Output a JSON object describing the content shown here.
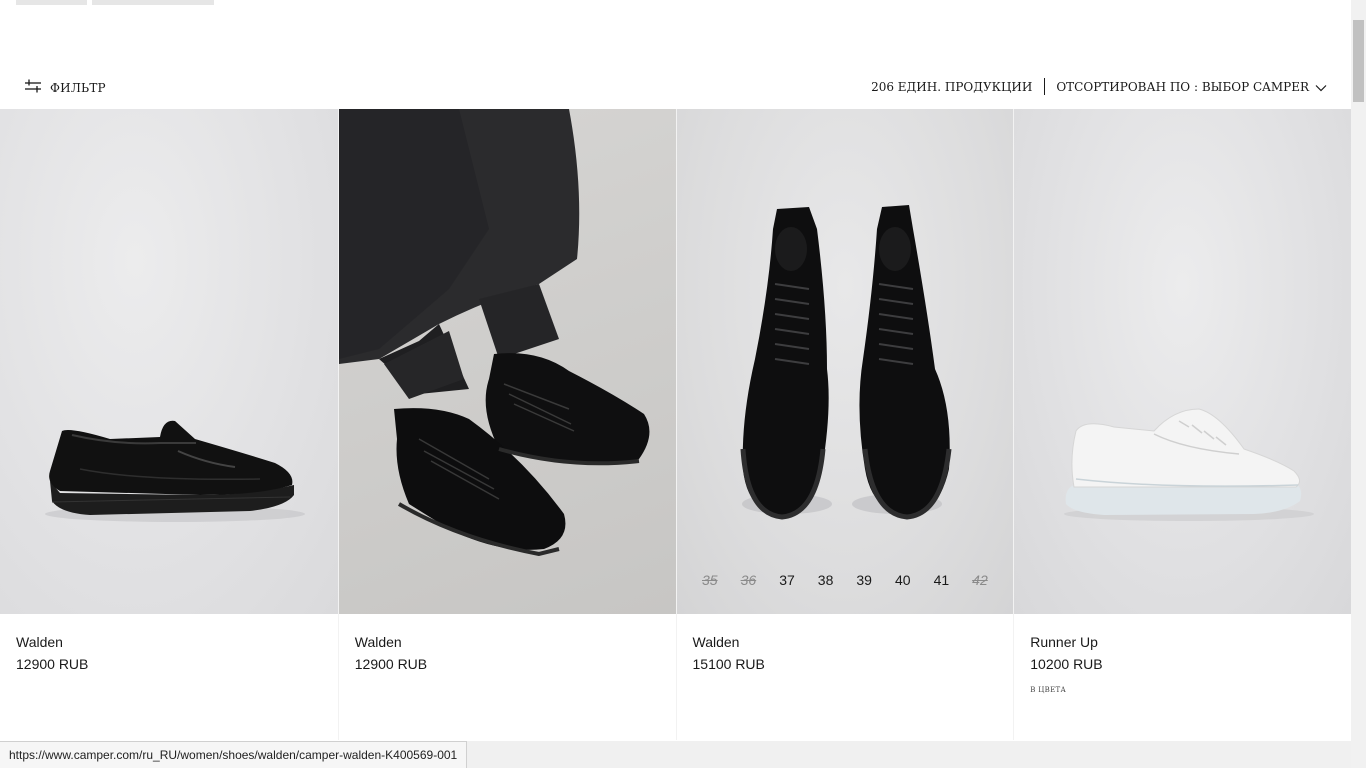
{
  "toolbar": {
    "filter_label": "ФИЛЬТР",
    "count_label": "206 ЕДИН. ПРОДУКЦИИ",
    "sort_label": "ОТСОРТИРОВАН ПО : ВЫБОР CAMPER"
  },
  "icons": {
    "filter": "filter-sliders-icon",
    "sort": "chevron-down-icon"
  },
  "products": [
    {
      "name": "Walden",
      "price": "12900 RUB"
    },
    {
      "name": "Walden",
      "price": "12900 RUB"
    },
    {
      "name": "Walden",
      "price": "15100 RUB",
      "sizes": [
        {
          "label": "35",
          "available": false
        },
        {
          "label": "36",
          "available": false
        },
        {
          "label": "37",
          "available": true
        },
        {
          "label": "38",
          "available": true
        },
        {
          "label": "39",
          "available": true
        },
        {
          "label": "40",
          "available": true
        },
        {
          "label": "41",
          "available": true
        },
        {
          "label": "42",
          "available": false
        }
      ]
    },
    {
      "name": "Runner Up",
      "price": "10200 RUB",
      "colors_label": "В ЦВЕТА"
    }
  ],
  "status_bar": {
    "url": "https://www.camper.com/ru_RU/women/shoes/walden/camper-walden-K400569-001"
  }
}
